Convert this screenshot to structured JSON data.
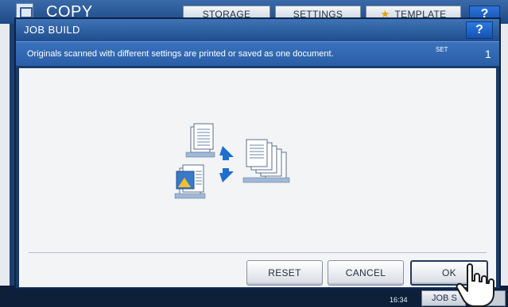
{
  "background": {
    "title": "COPY",
    "tabs": [
      {
        "label": "STORAGE"
      },
      {
        "label": "SETTINGS"
      },
      {
        "label": "TEMPLATE"
      }
    ],
    "help": "?",
    "time": "16:34",
    "job_status": "JOB S"
  },
  "dialog": {
    "title": "JOB BUILD",
    "help": "?",
    "info": "Originals scanned with different settings are printed or saved as one document.",
    "set_label": "SET",
    "set_value": "1",
    "buttons": {
      "reset": "RESET",
      "cancel": "CANCEL",
      "ok": "OK"
    }
  },
  "icons": {
    "illustration": "job-build-illustration-icon",
    "pointer": "pointing-hand-cursor-icon"
  },
  "colors": {
    "titlebar": "#2f63a6",
    "info_bar": "#3a72bd",
    "panel": "#f3f4f6",
    "accent_arrow": "#1f6fd1"
  }
}
